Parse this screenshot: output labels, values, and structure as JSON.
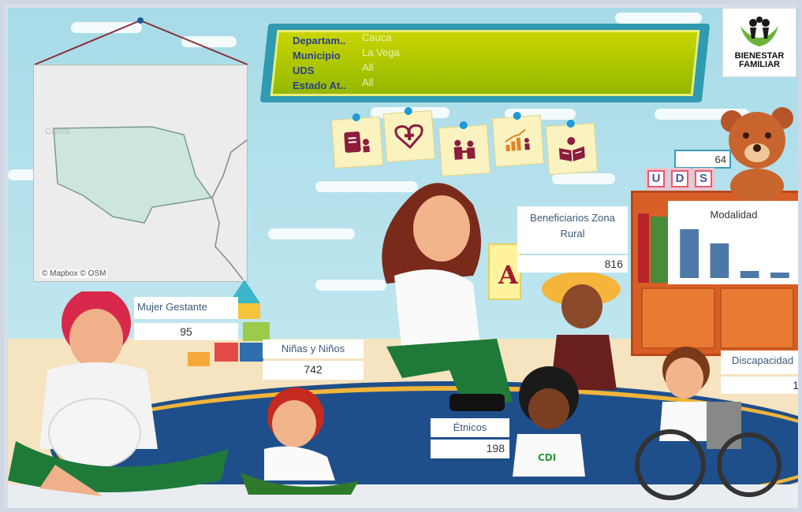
{
  "filters": [
    {
      "label": "Departam..",
      "value": "Cauca"
    },
    {
      "label": "Municipio",
      "value": "La Vega"
    },
    {
      "label": "UDS",
      "value": "All"
    },
    {
      "label": "Estado At..",
      "value": "All"
    }
  ],
  "logo": {
    "line1": "BIENESTAR",
    "line2": "FAMILIAR"
  },
  "map": {
    "label": "Cauca",
    "credit": "© Mapbox © OSM"
  },
  "uds": {
    "count": "64",
    "letters": [
      "U",
      "D",
      "S"
    ]
  },
  "modalidad_chart": {
    "title": "Modalidad"
  },
  "chart_data": {
    "type": "bar",
    "title": "Modalidad",
    "categories": [
      "",
      "",
      "",
      ""
    ],
    "values": [
      62,
      44,
      9,
      7
    ],
    "ylim": [
      0,
      70
    ],
    "color": "#4e79a7",
    "grid": false
  },
  "kpis": {
    "beneficiarios_rural": {
      "label_line1": "Beneficiarios Zona",
      "label_line2": "Rural",
      "value": "816"
    },
    "mujer_gestante": {
      "label": "Mujer Gestante",
      "value": "95"
    },
    "ninas_ninos": {
      "label": "Niñas y Niños",
      "value": "742"
    },
    "etnicos": {
      "label": "Étnicos",
      "value": "198"
    },
    "discapacidad": {
      "label": "Discapacidad",
      "value": "1"
    }
  },
  "colors": {
    "banner_green": "#b4c800",
    "banner_teal": "#2f9ab0",
    "label_text": "#3b5a78",
    "bar": "#4e79a7"
  }
}
